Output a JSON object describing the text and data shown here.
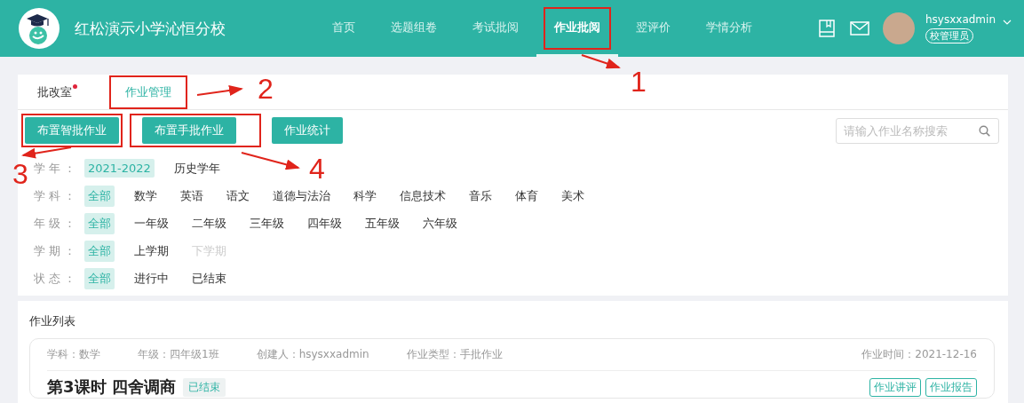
{
  "header": {
    "school_name": "红松演示小学沁恒分校",
    "nav": [
      {
        "label": "首页",
        "selected": false,
        "highlighted": false
      },
      {
        "label": "选题组卷",
        "selected": false,
        "highlighted": false
      },
      {
        "label": "考试批阅",
        "selected": false,
        "highlighted": false
      },
      {
        "label": "作业批阅",
        "selected": true,
        "highlighted": true
      },
      {
        "label": "翌评价",
        "selected": false,
        "highlighted": false
      },
      {
        "label": "学情分析",
        "selected": false,
        "highlighted": false
      }
    ],
    "user": {
      "name": "hsysxxadmin",
      "role": "校管理员"
    }
  },
  "tabs": [
    {
      "label": "批改室",
      "selected": false,
      "highlighted": false,
      "dot": true
    },
    {
      "label": "作业管理",
      "selected": true,
      "highlighted": true,
      "dot": false
    }
  ],
  "actions": [
    {
      "label": "布置智批作业",
      "highlighted": true
    },
    {
      "label": "布置手批作业",
      "highlighted": true
    },
    {
      "label": "作业统计",
      "highlighted": false
    }
  ],
  "search": {
    "placeholder": "请输入作业名称搜索"
  },
  "filters": [
    {
      "label": "学 年 ：",
      "options": [
        {
          "label": "2021-2022",
          "selected": true,
          "disabled": false
        },
        {
          "label": "历史学年",
          "selected": false,
          "disabled": false
        }
      ]
    },
    {
      "label": "学 科 ：",
      "options": [
        {
          "label": "全部",
          "selected": true,
          "disabled": false
        },
        {
          "label": "数学",
          "selected": false,
          "disabled": false
        },
        {
          "label": "英语",
          "selected": false,
          "disabled": false
        },
        {
          "label": "语文",
          "selected": false,
          "disabled": false
        },
        {
          "label": "道德与法治",
          "selected": false,
          "disabled": false
        },
        {
          "label": "科学",
          "selected": false,
          "disabled": false
        },
        {
          "label": "信息技术",
          "selected": false,
          "disabled": false
        },
        {
          "label": "音乐",
          "selected": false,
          "disabled": false
        },
        {
          "label": "体育",
          "selected": false,
          "disabled": false
        },
        {
          "label": "美术",
          "selected": false,
          "disabled": false
        }
      ]
    },
    {
      "label": "年 级 ：",
      "options": [
        {
          "label": "全部",
          "selected": true,
          "disabled": false
        },
        {
          "label": "一年级",
          "selected": false,
          "disabled": false
        },
        {
          "label": "二年级",
          "selected": false,
          "disabled": false
        },
        {
          "label": "三年级",
          "selected": false,
          "disabled": false
        },
        {
          "label": "四年级",
          "selected": false,
          "disabled": false
        },
        {
          "label": "五年级",
          "selected": false,
          "disabled": false
        },
        {
          "label": "六年级",
          "selected": false,
          "disabled": false
        }
      ]
    },
    {
      "label": "学 期 ：",
      "options": [
        {
          "label": "全部",
          "selected": true,
          "disabled": false
        },
        {
          "label": "上学期",
          "selected": false,
          "disabled": false
        },
        {
          "label": "下学期",
          "selected": false,
          "disabled": true
        }
      ]
    },
    {
      "label": "状 态 ：",
      "options": [
        {
          "label": "全部",
          "selected": true,
          "disabled": false
        },
        {
          "label": "进行中",
          "selected": false,
          "disabled": false
        },
        {
          "label": "已结束",
          "selected": false,
          "disabled": false
        }
      ]
    }
  ],
  "homework_list": {
    "title": "作业列表",
    "items": [
      {
        "subject": "学科：数学",
        "grade": "年级：四年级1班",
        "creator": "创建人：hsysxxadmin",
        "type": "作业类型：手批作业",
        "time": "作业时间：2021-12-16",
        "name": "第3课时 四舍调商",
        "status": "已结束",
        "buttons": [
          "作业讲评",
          "作业报告"
        ]
      }
    ]
  },
  "annotations": [
    {
      "label": "1"
    },
    {
      "label": "2"
    },
    {
      "label": "3"
    },
    {
      "label": "4"
    }
  ]
}
